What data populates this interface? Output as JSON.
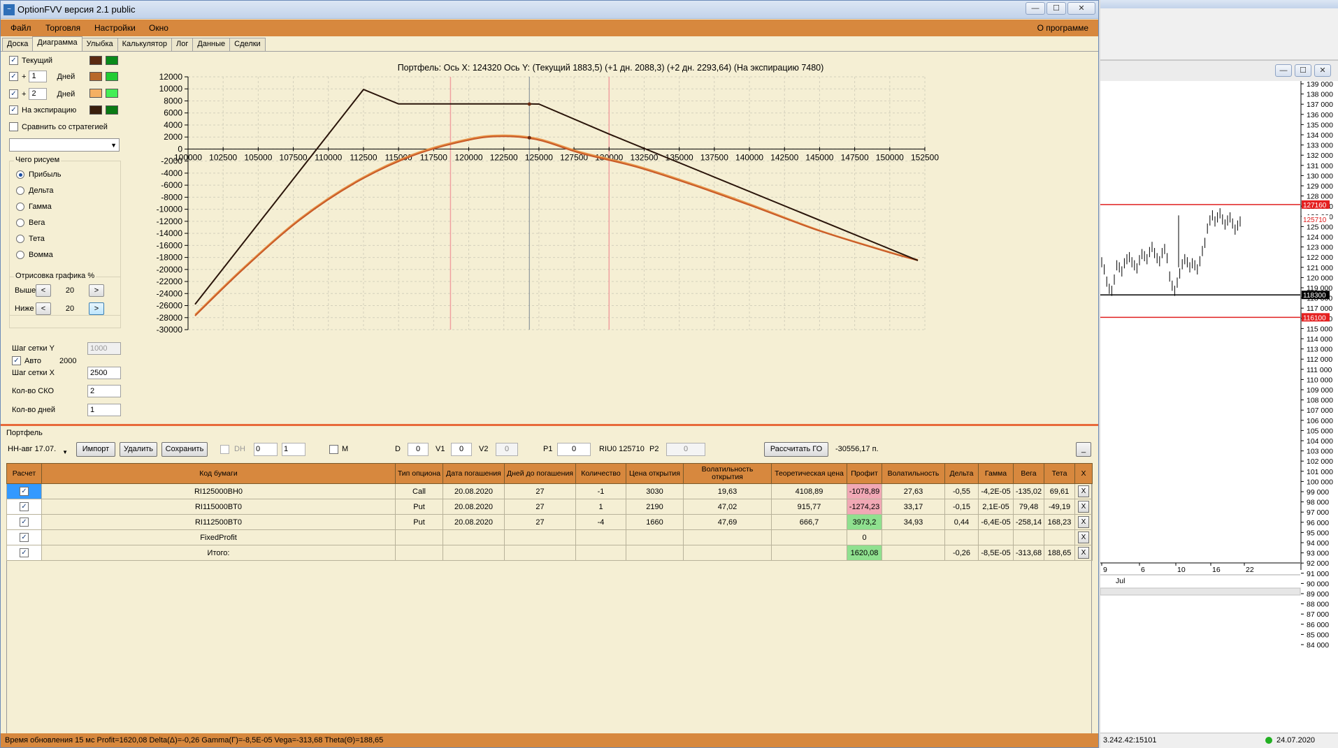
{
  "window": {
    "title": "OptionFVV версия 2.1 public",
    "buttons": [
      "—",
      "☐",
      "✕"
    ]
  },
  "menu": {
    "items": [
      "Файл",
      "Торговля",
      "Настройки",
      "Окно"
    ],
    "about": "О программе"
  },
  "tabs": [
    "Доска",
    "Диаграмма",
    "Улыбка",
    "Калькулятор",
    "Лог",
    "Данные",
    "Сделки"
  ],
  "left": {
    "current_label": "Текущий",
    "plus": "+",
    "days1": "1",
    "days_label": "Дней",
    "days2": "2",
    "expiry_label": "На экспирацию",
    "compare_label": "Сравнить со стратегией",
    "what_label": "Чего рисуем",
    "radios": [
      "Прибыль",
      "Дельта",
      "Гамма",
      "Вега",
      "Тета",
      "Вомма"
    ],
    "draw_label": "Отрисовка графика %",
    "above_label": "Выше",
    "above_val": "20",
    "below_label": "Ниже",
    "below_val": "20",
    "lt": "<",
    "gt": ">",
    "gridy_label": "Шаг сетки Y",
    "gridy_val": "1000",
    "auto_label": "Авто",
    "auto_val": "2000",
    "gridx_label": "Шаг сетки X",
    "gridx_val": "2500",
    "sko_label": "Кол-во СКО",
    "sko_val": "2",
    "ndays_label": "Кол-во дней",
    "ndays_val": "1",
    "colors": {
      "current": [
        "#5b2a12",
        "#0a8a1a"
      ],
      "plus1": [
        "#b8682a",
        "#22cc33"
      ],
      "plus2": [
        "#f4b063",
        "#44ee55"
      ],
      "expiry": [
        "#3a1f0c",
        "#0a7a14"
      ]
    }
  },
  "chart_title": "Портфель: Ось X: 124320 Ось Y:  (Текущий 1883,5)  (+1 дн. 2088,3)  (+2 дн. 2293,64)  (На экспирацию 7480)",
  "chart_data": {
    "type": "line",
    "xlim": [
      100000,
      152500
    ],
    "ylim": [
      -30000,
      12000
    ],
    "xticks": [
      100000,
      102500,
      105000,
      107500,
      110000,
      112500,
      115000,
      117500,
      120000,
      122500,
      125000,
      127500,
      130000,
      132500,
      135000,
      137500,
      140000,
      142500,
      145000,
      147500,
      150000,
      152500
    ],
    "xtick_labels": [
      "100000",
      "102500",
      "105000",
      "107500",
      "110000",
      "112500",
      "115000",
      "117500",
      "120000",
      "122500",
      "125000",
      "127500",
      "130000",
      "132500",
      "135000",
      "137500",
      "140000",
      "142500",
      "145000",
      "147500",
      "150000",
      "152500"
    ],
    "yticks": [
      12000,
      10000,
      8000,
      6000,
      4000,
      2000,
      0,
      -2000,
      -4000,
      -6000,
      -8000,
      -10000,
      -12000,
      -14000,
      -16000,
      -18000,
      -20000,
      -22000,
      -24000,
      -26000,
      -28000,
      -30000
    ],
    "ytick_labels": [
      "12000",
      "10000",
      "8000",
      "6000",
      "4000",
      "2000",
      "0",
      "-2000",
      "-4000",
      "-6000",
      "-8000",
      "-10000",
      "-12000",
      "-14000",
      "-16000",
      "-18000",
      "-20000",
      "-22000",
      "-24000",
      "-26000",
      "-28000",
      "-30000"
    ],
    "grid": true,
    "cursor_x": 124320,
    "red_lines_x": [
      118700,
      130000
    ],
    "series": [
      {
        "color": "#2a150a",
        "x": [
          100500,
          112500,
          115000,
          124320,
          125000,
          130000,
          152000
        ],
        "y": [
          -25800,
          9900,
          7500,
          7500,
          7480,
          2500,
          -18500
        ]
      },
      {
        "color": "#c85a28",
        "x": [
          100500,
          104000,
          108000,
          112000,
          116000,
          120000,
          122500,
          125000,
          128000,
          132000,
          136000,
          140000,
          145000,
          150000,
          152000
        ],
        "y": [
          -27700,
          -19800,
          -11700,
          -5500,
          -1100,
          1500,
          2100,
          1500,
          -700,
          -3000,
          -6000,
          -9300,
          -13600,
          -17200,
          -18500
        ]
      },
      {
        "color": "#e89448",
        "x": [
          100500,
          104000,
          108000,
          112000,
          116000,
          120000,
          122500,
          125000,
          128000,
          132000,
          136000,
          140000,
          145000,
          150000,
          152000
        ],
        "y": [
          -27500,
          -19600,
          -11500,
          -5300,
          -900,
          1700,
          2300,
          1700,
          -500,
          -2800,
          -5800,
          -9100,
          -13500,
          -17100,
          -18400
        ]
      }
    ],
    "markers": [
      {
        "x": 124320,
        "y": 7480
      },
      {
        "x": 124320,
        "y": 1883.5
      }
    ]
  },
  "portfolio": {
    "label": "Портфель",
    "select": "НН-авг 17.07.",
    "import": "Импорт",
    "delete": "Удалить",
    "save": "Сохранить",
    "dh": "DH",
    "dh_v1": "0",
    "dh_v2": "1",
    "m": "M",
    "d_label": "D",
    "d_val": "0",
    "v1_label": "V1",
    "v1_val": "0",
    "v2_label": "V2",
    "v2_val": "0",
    "p1_label": "P1",
    "p1_val": "0",
    "riu": "RIU0 125710",
    "p2_label": "P2",
    "p2_val": "0",
    "calc_go": "Рассчитать ГО",
    "go_val": "-30556,17 п.",
    "minimize": "_"
  },
  "table": {
    "headers": [
      "Расчет",
      "Код бумаги",
      "Тип опциона",
      "Дата погашения",
      "Дней до погашения",
      "Количество",
      "Цена открытия",
      "Волатильность открытия",
      "Теоретическая цена",
      "Профит",
      "Волатильность",
      "Дельта",
      "Гамма",
      "Вега",
      "Тета",
      "X"
    ],
    "rows": [
      [
        "✓",
        "RI125000BH0",
        "Call",
        "20.08.2020",
        "27",
        "-1",
        "3030",
        "19,63",
        "4108,89",
        "-1078,89",
        "27,63",
        "-0,55",
        "-4,2E-05",
        "-135,02",
        "69,61",
        "X"
      ],
      [
        "✓",
        "RI115000BT0",
        "Put",
        "20.08.2020",
        "27",
        "1",
        "2190",
        "47,02",
        "915,77",
        "-1274,23",
        "33,17",
        "-0,15",
        "2,1E-05",
        "79,48",
        "-49,19",
        "X"
      ],
      [
        "✓",
        "RI112500BT0",
        "Put",
        "20.08.2020",
        "27",
        "-4",
        "1660",
        "47,69",
        "666,7",
        "3973,2",
        "34,93",
        "0,44",
        "-6,4E-05",
        "-258,14",
        "168,23",
        "X"
      ],
      [
        "✓",
        "FixedProfit",
        "",
        "",
        "",
        "",
        "",
        "",
        "",
        "0",
        "",
        "",
        "",
        "",
        "",
        "X"
      ],
      [
        "✓",
        "Итого:",
        "",
        "",
        "",
        "",
        "",
        "",
        "",
        "1620,08",
        "",
        "-0,26",
        "-8,5E-05",
        "-313,68",
        "188,65",
        "X"
      ]
    ]
  },
  "status": "Время обновления 15 мс  Profit=1620,08 Delta(Δ)=-0,26 Gamma(Γ)=-8,5E-05 Vega=-313,68 Theta(Θ)=188,65",
  "right": {
    "price_labels": [
      "139 000",
      "138 000",
      "137 000",
      "136 000",
      "135 000",
      "134 000",
      "133 000",
      "132 000",
      "131 000",
      "130 000",
      "129 000",
      "128 000",
      "127 000",
      "126 000",
      "125 000",
      "124 000",
      "123 000",
      "122 000",
      "121 000",
      "120 000",
      "119 000",
      "118 000",
      "117 000",
      "116 000",
      "115 000",
      "114 000",
      "113 000",
      "112 000",
      "111 000",
      "110 000",
      "109 000",
      "108 000",
      "107 000",
      "106 000",
      "105 000",
      "104 000",
      "103 000",
      "102 000",
      "101 000",
      "100 000",
      "99 000",
      "98 000",
      "97 000",
      "96 000",
      "95 000",
      "94 000",
      "93 000",
      "92 000",
      "91 000",
      "90 000",
      "89 000",
      "88 000",
      "87 000",
      "86 000",
      "85 000",
      "84 000"
    ],
    "tag_top": "127160",
    "tag_price": "125710",
    "tag_black": "118300",
    "tag_bottom": "116100",
    "date_labels": [
      "9",
      "6",
      "10",
      "16",
      "22"
    ],
    "month": "Jul",
    "ip": "3.242.42:15101",
    "date": "24.07.2020"
  }
}
